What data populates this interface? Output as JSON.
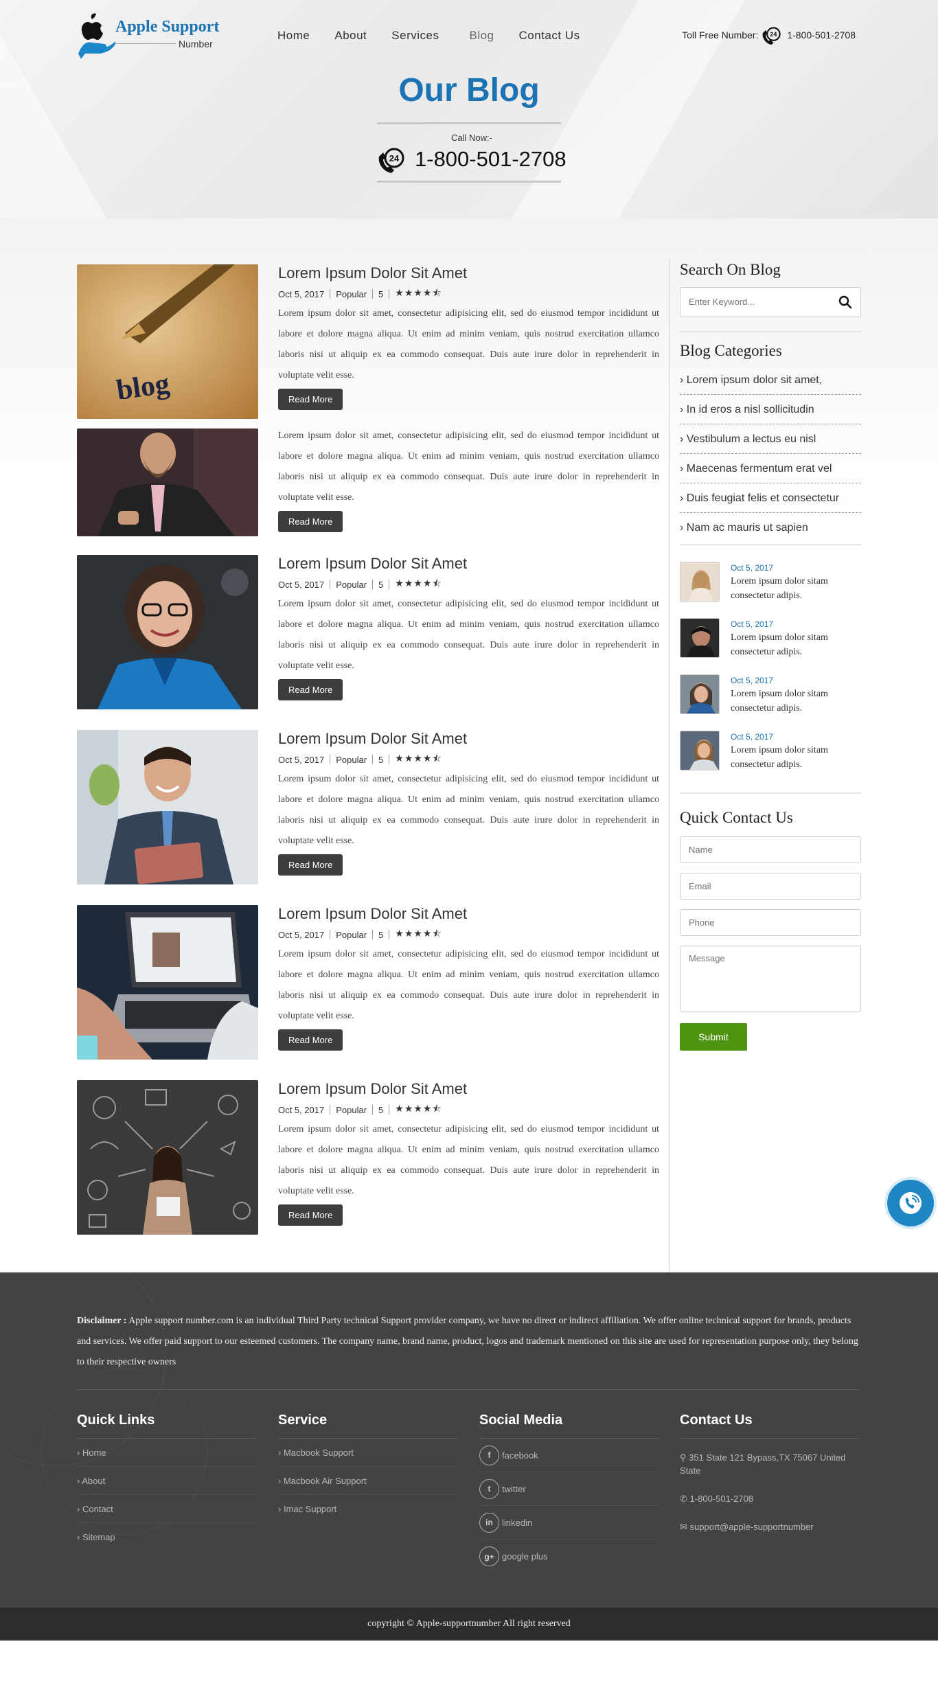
{
  "brand": {
    "title": "Apple Support",
    "subtitle": "Number",
    "color": "#1b73b3"
  },
  "nav": [
    {
      "label": "Home"
    },
    {
      "label": "About"
    },
    {
      "label": "Services"
    },
    {
      "label": "Blog",
      "active": true
    },
    {
      "label": "Contact Us"
    }
  ],
  "tollfree": {
    "label": "Toll Free Number:",
    "number": "1-800-501-2708"
  },
  "hero": {
    "title_bold": "Our",
    "title_rest": "Blog",
    "call_label": "Call Now:-",
    "phone": "1-800-501-2708"
  },
  "posts": [
    {
      "has_title": true,
      "title": "Lorem Ipsum Dolor Sit Amet",
      "date": "Oct 5, 2017",
      "category": "Popular",
      "count": "5",
      "rating": 4.5,
      "text": "Lorem ipsum dolor sit amet, consectetur adipisicing elit, sed do eiusmod tempor incididunt ut labore et dolore magna aliqua. Ut enim ad minim veniam, quis nostrud exercitation ullamco laboris nisi ut aliquip ex ea commodo consequat. Duis aute irure dolor in reprehenderit in voluptate velit esse.",
      "button": "Read More",
      "image": "blog-pen-photo"
    },
    {
      "has_title": false,
      "text": "Lorem ipsum dolor sit amet, consectetur adipisicing elit, sed do eiusmod tempor incididunt ut labore et dolore magna aliqua. Ut enim ad minim veniam, quis nostrud exercitation ullamco laboris nisi ut aliquip ex ea commodo consequat. Duis aute irure dolor in reprehenderit in voluptate velit esse.",
      "button": "Read More",
      "image": "bearded-man-photo"
    },
    {
      "has_title": true,
      "title": "Lorem Ipsum Dolor Sit Amet",
      "date": "Oct 5, 2017",
      "category": "Popular",
      "count": "5",
      "rating": 4.5,
      "text": "Lorem ipsum dolor sit amet, consectetur adipisicing elit, sed do eiusmod tempor incididunt ut labore et dolore magna aliqua. Ut enim ad minim veniam, quis nostrud exercitation ullamco laboris nisi ut aliquip ex ea commodo consequat. Duis aute irure dolor in reprehenderit in voluptate velit esse.",
      "button": "Read More",
      "image": "woman-glasses-photo"
    },
    {
      "has_title": true,
      "title": "Lorem Ipsum Dolor Sit Amet",
      "date": "Oct 5, 2017",
      "category": "Popular",
      "count": "5",
      "rating": 4.5,
      "text": "Lorem ipsum dolor sit amet, consectetur adipisicing elit, sed do eiusmod tempor incididunt ut labore et dolore magna aliqua. Ut enim ad minim veniam, quis nostrud exercitation ullamco laboris nisi ut aliquip ex ea commodo consequat. Duis aute irure dolor in reprehenderit in voluptate velit esse.",
      "button": "Read More",
      "image": "man-tablet-photo"
    },
    {
      "has_title": true,
      "title": "Lorem Ipsum Dolor Sit Amet",
      "date": "Oct 5, 2017",
      "category": "Popular",
      "count": "5",
      "rating": 4.5,
      "text": "Lorem ipsum dolor sit amet, consectetur adipisicing elit, sed do eiusmod tempor incididunt ut labore et dolore magna aliqua. Ut enim ad minim veniam, quis nostrud exercitation ullamco laboris nisi ut aliquip ex ea commodo consequat. Duis aute irure dolor in reprehenderit in voluptate velit esse.",
      "button": "Read More",
      "image": "laptop-photo"
    },
    {
      "has_title": true,
      "title": "Lorem Ipsum Dolor Sit Amet",
      "date": "Oct 5, 2017",
      "category": "Popular",
      "count": "5",
      "rating": 4.5,
      "text": "Lorem ipsum dolor sit amet, consectetur adipisicing elit, sed do eiusmod tempor incididunt ut labore et dolore magna aliqua. Ut enim ad minim veniam, quis nostrud exercitation ullamco laboris nisi ut aliquip ex ea commodo consequat. Duis aute irure dolor in reprehenderit in voluptate velit esse.",
      "button": "Read More",
      "image": "chalkboard-woman-photo"
    }
  ],
  "sidebar": {
    "search": {
      "title": "Search On Blog",
      "placeholder": "Enter Keyword..."
    },
    "categories": {
      "title": "Blog Categories",
      "items": [
        "Lorem ipsum dolor sit amet,",
        "In id eros a nisl sollicitudin",
        "Vestibulum a lectus eu nisl",
        "Maecenas fermentum erat vel",
        "Duis feugiat felis et consectetur",
        "Nam ac mauris ut sapien"
      ]
    },
    "recent": [
      {
        "date": "Oct 5, 2017",
        "text": "Lorem ipsum dolor sitam consectetur adipis."
      },
      {
        "date": "Oct 5, 2017",
        "text": "Lorem ipsum dolor sitam consectetur adipis."
      },
      {
        "date": "Oct 5, 2017",
        "text": "Lorem ipsum dolor sitam consectetur adipis."
      },
      {
        "date": "Oct 5, 2017",
        "text": "Lorem ipsum dolor sitam consectetur adipis."
      }
    ],
    "quick_contact": {
      "title": "Quick Contact Us",
      "name_placeholder": "Name",
      "email_placeholder": "Email",
      "phone_placeholder": "Phone",
      "message_placeholder": "Message",
      "submit": "Submit",
      "submit_color": "#4f9410"
    }
  },
  "footer": {
    "disclaimer_label": "Disclaimer :",
    "disclaimer_text": "Apple support number.com is an individual Third Party technical Support provider company, we have no direct or indirect affiliation. We offer online technical support for brands, products and services. We offer paid support to our esteemed customers. The company name, brand name, product, logos and trademark mentioned on this site are used for representation purpose only, they belong to their respective owners",
    "quick_links": {
      "title": "Quick Links",
      "items": [
        "Home",
        "About",
        "Contact",
        "Sitemap"
      ]
    },
    "service": {
      "title": "Service",
      "items": [
        "Macbook Support",
        "Macbook Air Support",
        "Imac Support"
      ]
    },
    "social": {
      "title": "Social Media",
      "items": [
        {
          "label": "facebook",
          "icon": "facebook-icon"
        },
        {
          "label": "twitter",
          "icon": "twitter-icon"
        },
        {
          "label": "linkedin",
          "icon": "linkedin-icon"
        },
        {
          "label": "google plus",
          "icon": "google-plus-icon"
        }
      ]
    },
    "contact": {
      "title": "Contact Us",
      "address": "351 State 121 Bypass,TX 75067 United State",
      "phone": "1-800-501-2708",
      "email": "support@apple-supportnumber"
    },
    "copyright": "copyright © Apple-supportnumber All right reserved"
  }
}
